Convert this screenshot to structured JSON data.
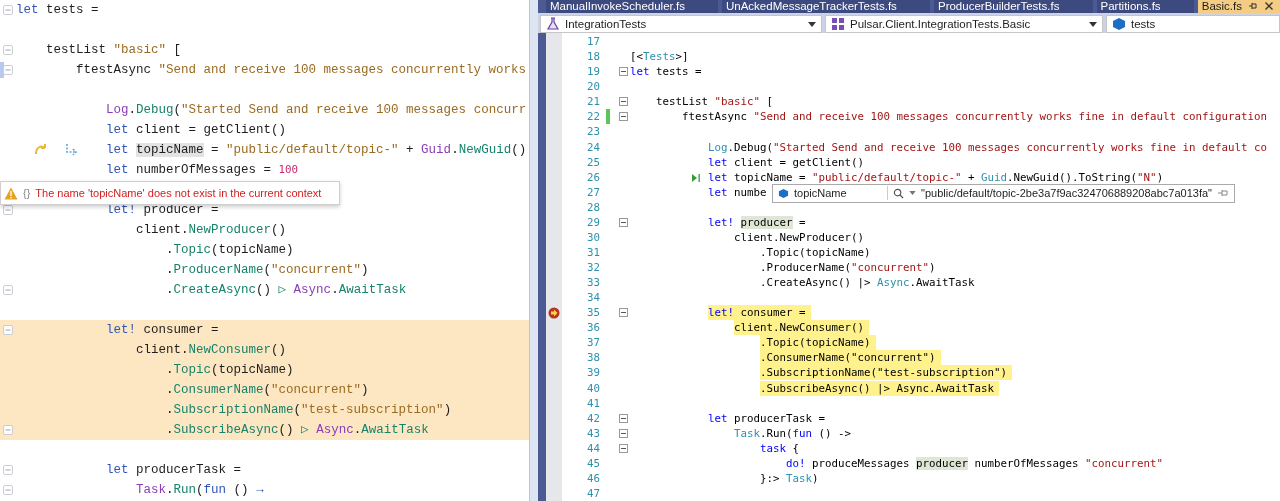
{
  "left_editor": {
    "lines": [
      {
        "kind": "code",
        "tokens": [
          {
            "kind": "kw",
            "text": "let"
          },
          " tests ="
        ],
        "fold": true
      },
      {
        "kind": "blank"
      },
      {
        "kind": "code",
        "tokens": [
          "    testList ",
          {
            "kind": "str",
            "text": "\"basic\""
          },
          " ["
        ],
        "fold": true
      },
      {
        "kind": "code",
        "tokens": [
          "        ftestAsync ",
          {
            "kind": "str",
            "text": "\"Send and receive 100 messages concurrently works"
          }
        ],
        "fold": true,
        "gutter": {
          "kind": "bookmark"
        }
      },
      {
        "kind": "blank"
      },
      {
        "kind": "code",
        "tokens": [
          {
            "kind": "type",
            "text": "            Log"
          },
          ".",
          {
            "kind": "method",
            "text": "Debug"
          },
          "(",
          {
            "kind": "str",
            "text": "\"Started Send and receive 100 messages concurr"
          }
        ]
      },
      {
        "kind": "code",
        "tokens": [
          {
            "kind": "kw",
            "text": "            let"
          },
          " client = getClient()"
        ]
      },
      {
        "kind": "code",
        "tokens": [
          {
            "kind": "kw",
            "text": "            let "
          },
          {
            "kind": "ref",
            "text": "topicName"
          },
          " = ",
          {
            "kind": "str",
            "text": "\"public/default/topic-\""
          },
          " + ",
          {
            "kind": "type",
            "text": "Guid"
          },
          ".",
          {
            "kind": "method",
            "text": "NewGuid"
          },
          "()"
        ],
        "gutter": {
          "kind": "step"
        }
      },
      {
        "kind": "code",
        "tokens": [
          {
            "kind": "kw",
            "text": "            let"
          },
          " numberOfMessages = ",
          {
            "kind": "num",
            "text": "100"
          }
        ]
      },
      {
        "kind": "blank"
      },
      {
        "kind": "code",
        "tokens": [
          {
            "kind": "kw",
            "text": "            let!"
          },
          " producer ="
        ],
        "fold": true
      },
      {
        "kind": "code",
        "tokens": [
          "                client.",
          {
            "kind": "method",
            "text": "NewProducer"
          },
          "()"
        ]
      },
      {
        "kind": "code",
        "tokens": [
          "                    .",
          {
            "kind": "method",
            "text": "Topic"
          },
          "(topicName)"
        ]
      },
      {
        "kind": "code",
        "tokens": [
          "                    .",
          {
            "kind": "method",
            "text": "ProducerName"
          },
          "(",
          {
            "kind": "str",
            "text": "\"concurrent\""
          },
          ")"
        ]
      },
      {
        "kind": "code",
        "tokens": [
          "                    .",
          {
            "kind": "method",
            "text": "CreateAsync"
          },
          "() ",
          {
            "kind": "op",
            "text": "▷ "
          },
          {
            "kind": "type",
            "text": "Async"
          },
          ".",
          {
            "kind": "method",
            "text": "AwaitTask"
          }
        ],
        "fold": true
      },
      {
        "kind": "blank"
      },
      {
        "kind": "code",
        "tokens": [
          {
            "kind": "kw",
            "text": "            let!"
          },
          " consumer ="
        ],
        "fold": true,
        "highlight": true
      },
      {
        "kind": "code",
        "tokens": [
          "                client.",
          {
            "kind": "method",
            "text": "NewConsumer"
          },
          "()"
        ],
        "highlight": true
      },
      {
        "kind": "code",
        "tokens": [
          "                    .",
          {
            "kind": "method",
            "text": "Topic"
          },
          "(topicName)"
        ],
        "highlight": true
      },
      {
        "kind": "code",
        "tokens": [
          "                    .",
          {
            "kind": "method",
            "text": "ConsumerName"
          },
          "(",
          {
            "kind": "str",
            "text": "\"concurrent\""
          },
          ")"
        ],
        "highlight": true
      },
      {
        "kind": "code",
        "tokens": [
          "                    .",
          {
            "kind": "method",
            "text": "SubscriptionName"
          },
          "(",
          {
            "kind": "str",
            "text": "\"test-subscription\""
          },
          ")"
        ],
        "highlight": true
      },
      {
        "kind": "code",
        "tokens": [
          "                    .",
          {
            "kind": "method",
            "text": "SubscribeAsync"
          },
          "() ",
          {
            "kind": "op",
            "text": "▷ "
          },
          {
            "kind": "type",
            "text": "Async"
          },
          ".",
          {
            "kind": "method",
            "text": "AwaitTask"
          }
        ],
        "fold": true,
        "highlight": true
      },
      {
        "kind": "blank"
      },
      {
        "kind": "code",
        "tokens": [
          {
            "kind": "kw",
            "text": "            let"
          },
          " producerTask ="
        ],
        "fold": true
      },
      {
        "kind": "code",
        "tokens": [
          {
            "kind": "type",
            "text": "                Task"
          },
          ".",
          {
            "kind": "method",
            "text": "Run"
          },
          "(",
          {
            "kind": "kw",
            "text": "fun"
          },
          " () ",
          {
            "kind": "arrow",
            "text": "→"
          }
        ],
        "fold": true
      }
    ],
    "error_tooltip": {
      "symbol": "{}",
      "message": "The name 'topicName' does not exist in the current context"
    }
  },
  "right_editor": {
    "tabs": [
      {
        "label": "ManualInvokeScheduler.fs",
        "selected": false
      },
      {
        "label": "UnAckedMessageTrackerTests.fs",
        "selected": false
      },
      {
        "label": "ProducerBuilderTests.fs",
        "selected": false
      },
      {
        "label": "Partitions.fs",
        "selected": false
      },
      {
        "label": "Basic.fs",
        "selected": true
      }
    ],
    "navigation": [
      {
        "kind": "project",
        "label": "IntegrationTests",
        "dropdown": true
      },
      {
        "kind": "module",
        "label": "Pulsar.Client.IntegrationTests.Basic",
        "dropdown": true
      },
      {
        "kind": "member",
        "label": "tests",
        "dropdown": false
      }
    ],
    "lines": [
      {
        "number": "17"
      },
      {
        "number": "18",
        "tokens": [
          "[<",
          {
            "kind": "type",
            "text": "Tests"
          },
          ">]"
        ]
      },
      {
        "number": "19",
        "tokens": [
          {
            "kind": "kw",
            "text": "let"
          },
          " tests ="
        ],
        "fold": true
      },
      {
        "number": "20"
      },
      {
        "number": "21",
        "tokens": [
          "    testList ",
          {
            "kind": "str",
            "text": "\"basic\""
          },
          " ["
        ],
        "fold": true
      },
      {
        "number": "22",
        "tokens": [
          "        ftestAsync ",
          {
            "kind": "str",
            "text": "\"Send and receive 100 messages concurrently works fine in default configuration"
          }
        ],
        "fold": true,
        "gutter": {
          "kind": "changed"
        }
      },
      {
        "number": "23"
      },
      {
        "number": "24",
        "tokens": [
          {
            "kind": "type",
            "text": "            Log"
          },
          ".Debug(",
          {
            "kind": "str",
            "text": "\"Started Send and receive 100 messages concurrently works fine in default co"
          }
        ]
      },
      {
        "number": "25",
        "tokens": [
          {
            "kind": "kw",
            "text": "            let"
          },
          " client = getClient()"
        ]
      },
      {
        "number": "26",
        "tokens": [
          {
            "kind": "kw",
            "text": "            let"
          },
          " topicName = ",
          {
            "kind": "str",
            "text": "\"public/default/topic-\""
          },
          " + ",
          {
            "kind": "type",
            "text": "Guid"
          },
          ".NewGuid().ToString(",
          {
            "kind": "str",
            "text": "\"N\""
          },
          ")"
        ],
        "gutter": {
          "kind": "run-to"
        }
      },
      {
        "number": "27",
        "tokens": [
          {
            "kind": "kw",
            "text": "            let"
          },
          " numbe"
        ],
        "data_tip": {
          "name": "topicName",
          "value": "\"public/default/topic-2be3a7f9ac324706889208abc7a013fa\""
        }
      },
      {
        "number": "28"
      },
      {
        "number": "29",
        "tokens": [
          {
            "kind": "kw",
            "text": "            let! "
          },
          {
            "kind": "ref",
            "text": "producer"
          },
          " ="
        ],
        "fold": true
      },
      {
        "number": "30",
        "tokens": [
          "                client.NewProducer()"
        ]
      },
      {
        "number": "31",
        "tokens": [
          "                    .Topic(topicName)"
        ]
      },
      {
        "number": "32",
        "tokens": [
          "                    .ProducerName(",
          {
            "kind": "str",
            "text": "\"concurrent\""
          },
          ")"
        ]
      },
      {
        "number": "33",
        "tokens": [
          "                    .CreateAsync() |> ",
          {
            "kind": "type",
            "text": "Async"
          },
          ".AwaitTask"
        ]
      },
      {
        "number": "34"
      },
      {
        "number": "35",
        "tokens": [
          {
            "kind": "kw",
            "text": "            let!"
          },
          " consumer ="
        ],
        "fold": true,
        "highlight": true,
        "gutter": {
          "kind": "breakpoint"
        }
      },
      {
        "number": "36",
        "tokens": [
          "                client.NewConsumer()"
        ],
        "highlight": true
      },
      {
        "number": "37",
        "tokens": [
          "                    .Topic(topicName)"
        ],
        "highlight": true
      },
      {
        "number": "38",
        "tokens": [
          "                    .ConsumerName(\"concurrent\")"
        ],
        "highlight": true
      },
      {
        "number": "39",
        "tokens": [
          "                    .SubscriptionName(\"test-subscription\")"
        ],
        "highlight": true
      },
      {
        "number": "40",
        "tokens": [
          "                    .SubscribeAsync() |> Async.AwaitTask"
        ],
        "highlight": true
      },
      {
        "number": "41"
      },
      {
        "number": "42",
        "tokens": [
          {
            "kind": "kw",
            "text": "            let"
          },
          " producerTask ="
        ],
        "fold": true
      },
      {
        "number": "43",
        "tokens": [
          {
            "kind": "type",
            "text": "                Task"
          },
          ".Run(",
          {
            "kind": "kw",
            "text": "fun"
          },
          " () ->"
        ],
        "fold": true
      },
      {
        "number": "44",
        "tokens": [
          {
            "kind": "kw",
            "text": "                    task"
          },
          " {"
        ],
        "fold": true
      },
      {
        "number": "45",
        "tokens": [
          {
            "kind": "kw",
            "text": "                        do!"
          },
          " produceMessages ",
          {
            "kind": "ref",
            "text": "producer"
          },
          " numberOfMessages ",
          {
            "kind": "str",
            "text": "\"concurrent\""
          }
        ]
      },
      {
        "number": "46",
        "tokens": [
          "                    }:> ",
          {
            "kind": "type",
            "text": "Task"
          },
          ")"
        ]
      },
      {
        "number": "47"
      }
    ]
  }
}
